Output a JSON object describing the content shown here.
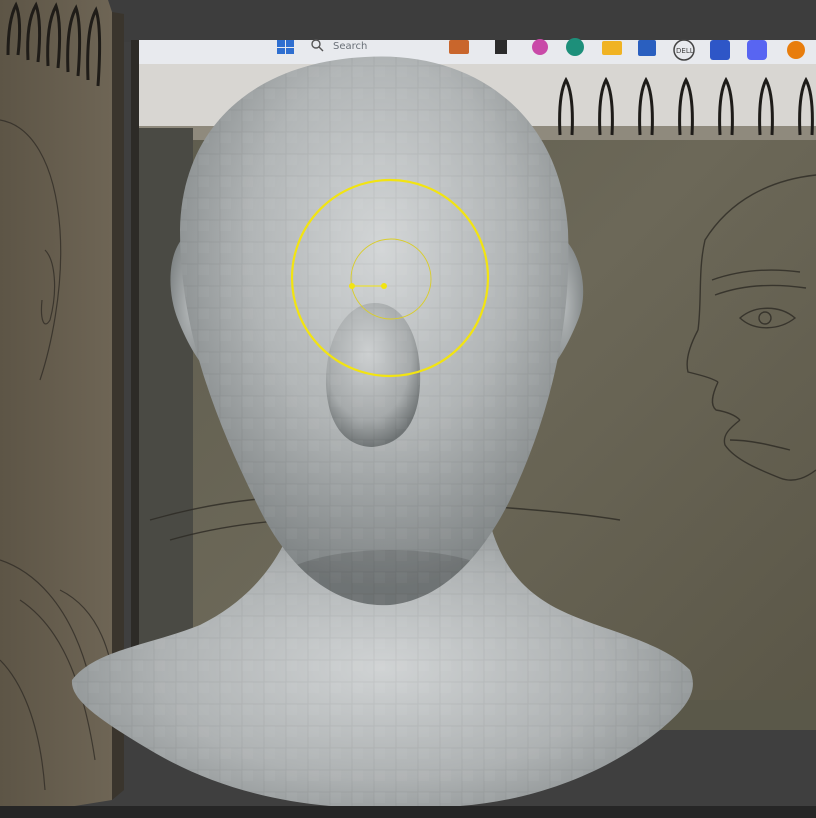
{
  "viewport": {
    "background": "#3f3f3f"
  },
  "reference_taskbar": {
    "search_label": "Search",
    "dell_logo": "DELL",
    "icons": [
      "windows-start-icon",
      "search-icon",
      "app-icon",
      "file-icon",
      "copilot-icon",
      "edge-icon",
      "folder-icon",
      "store-icon",
      "dell-icon",
      "security-icon",
      "discord-icon",
      "blender-icon"
    ]
  },
  "sculpt_brush": {
    "color": "#f2e411"
  },
  "mesh": {
    "base_color": "#b9bcbd"
  }
}
